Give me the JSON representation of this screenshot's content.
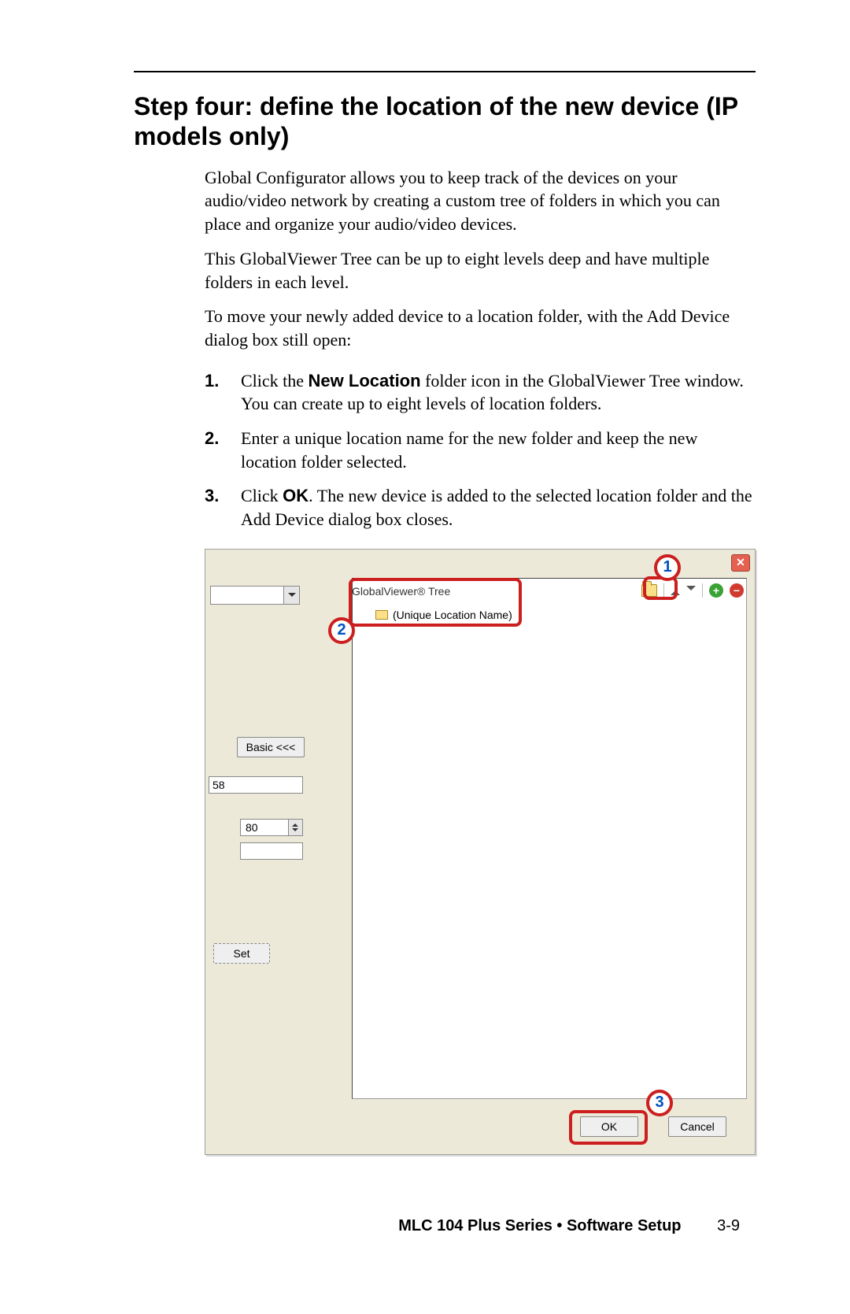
{
  "heading": "Step four: define the location of the new device (IP models only)",
  "paragraphs": {
    "p1": "Global Configurator allows you to keep track of the devices on your audio/video network by creating a custom tree of folders in which you can place and organize your audio/video devices.",
    "p2": "This GlobalViewer Tree can be up to eight levels deep and have multiple folders in each level.",
    "p3": "To move your newly added device to a location folder, with the Add Device dialog box still open:"
  },
  "steps": {
    "s1_pre": "Click the ",
    "s1_bold": "New Location",
    "s1_post": " folder icon in the GlobalViewer Tree window.  You can create up to eight levels of location folders.",
    "s2": "Enter a unique location name for the new folder and keep the new location folder selected.",
    "s3_pre": "Click ",
    "s3_bold": "OK",
    "s3_post": ".  The new device is added to the selected location folder and the Add Device dialog box closes."
  },
  "dialog": {
    "tree_label": "GlobalViewer® Tree",
    "tree_item": "(Unique Location Name)",
    "basic_btn": "Basic <<<",
    "val58": "58",
    "val80": "80",
    "set_btn": "Set",
    "ok_btn": "OK",
    "cancel_btn": "Cancel",
    "close_x": "✕"
  },
  "callouts": {
    "c1": "1",
    "c2": "2",
    "c3": "3"
  },
  "footer": {
    "title": "MLC 104 Plus Series • Software Setup",
    "page": "3-9"
  }
}
